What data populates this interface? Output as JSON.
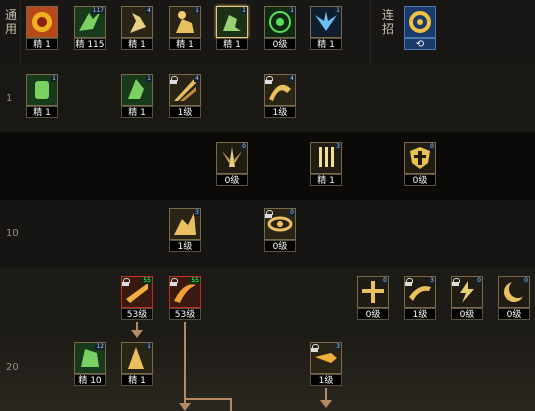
{
  "sidebar": {
    "general_label": "通用",
    "combo_label": "连招"
  },
  "rows": {
    "row1_level": "1",
    "row3_level": "10",
    "row5_level": "20"
  },
  "general_skills": [
    {
      "label": "精 1",
      "badge": ""
    },
    {
      "label": "精 115",
      "badge": "117"
    },
    {
      "label": "精 1",
      "badge": "4"
    },
    {
      "label": "精 1",
      "badge": "1"
    },
    {
      "label": "精 1",
      "badge": "1"
    },
    {
      "label": "0级",
      "badge": "1"
    },
    {
      "label": "精 1",
      "badge": "1"
    }
  ],
  "row1": [
    {
      "label": "精 1",
      "badge": "1"
    },
    {
      "label": "精 1",
      "badge": "1"
    },
    {
      "label": "1级",
      "badge": "4"
    },
    {
      "label": "1级",
      "badge": "4"
    }
  ],
  "row2": [
    {
      "label": "0级",
      "badge": "0"
    },
    {
      "label": "精 1",
      "badge": "3"
    },
    {
      "label": "0级",
      "badge": "0"
    }
  ],
  "row3": [
    {
      "label": "1级",
      "badge": "3"
    },
    {
      "label": "0级",
      "badge": "0"
    }
  ],
  "row4": [
    {
      "label": "53级",
      "badge": "55"
    },
    {
      "label": "53级",
      "badge": "55"
    },
    {
      "label": "0级",
      "badge": "0"
    },
    {
      "label": "1级",
      "badge": "3"
    },
    {
      "label": "0级",
      "badge": "0"
    },
    {
      "label": "0级",
      "badge": "0"
    }
  ],
  "row5": [
    {
      "label": "精 10",
      "badge": "12"
    },
    {
      "label": "精 1",
      "badge": "1"
    },
    {
      "label": "1级",
      "badge": "3"
    }
  ]
}
